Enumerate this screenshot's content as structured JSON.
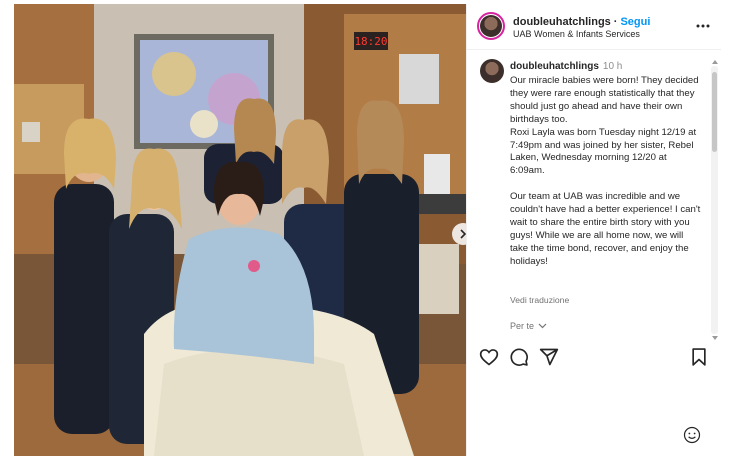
{
  "post": {
    "username": "doubleuhatchlings",
    "follow_label": "Segui",
    "location": "UAB Women & Infants Services",
    "time": "10 h",
    "caption_paragraphs": [
      "Our miracle babies were born! They decided they were rare enough statistically that they should just go ahead and have their own birthdays too.",
      "Roxi Layla was born Tuesday night 12/19 at 7:49pm and was joined by her sister, Rebel Laken, Wednesday morning 12/20 at 6:09am.",
      "Our team at UAB was incredible and we couldn't have had a better experience! I can't wait to share the entire birth story with you guys! While we are all home now, we will take the time bond, recover, and enjoy the holidays!"
    ],
    "translate_label": "Vedi traduzione",
    "for_you_label": "Per te"
  },
  "photo": {
    "clock_display": "18:20"
  },
  "icons": {
    "more": "more-horizontal-icon",
    "like": "heart-icon",
    "comment": "comment-icon",
    "share": "send-icon",
    "save": "bookmark-icon",
    "emoji": "emoji-icon",
    "next": "chevron-right-icon"
  },
  "colors": {
    "follow": "#0095f6",
    "text": "#262626",
    "secondary": "#737373",
    "scrubs": "#1f2a44"
  }
}
